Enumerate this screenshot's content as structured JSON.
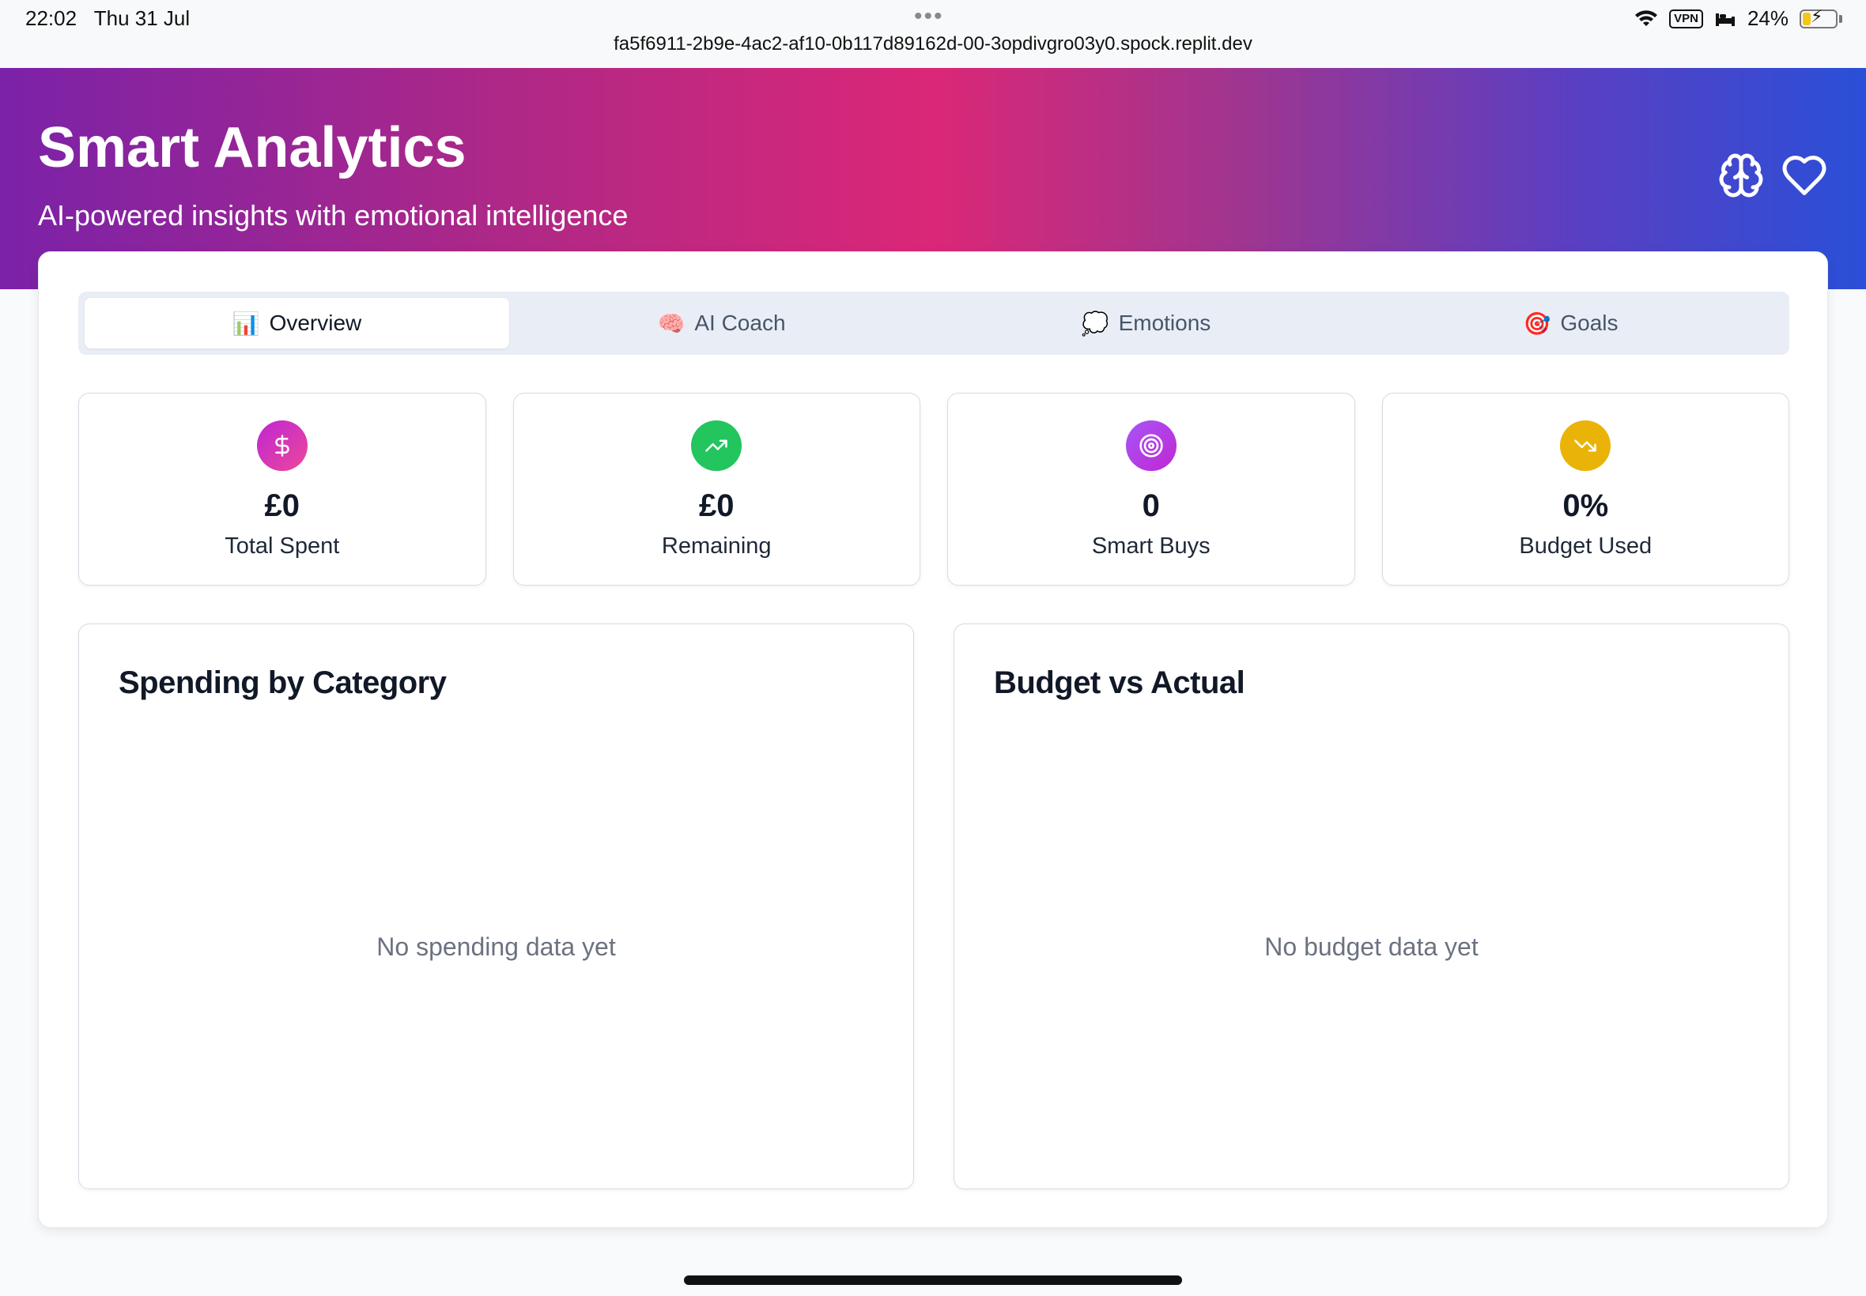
{
  "status_bar": {
    "time": "22:02",
    "date": "Thu 31 Jul",
    "url": "fa5f6911-2b9e-4ac2-af10-0b117d89162d-00-3opdivgro03y0.spock.replit.dev",
    "vpn": "VPN",
    "battery_percent": "24%",
    "battery_level": 0.24
  },
  "header": {
    "title": "Smart Analytics",
    "subtitle": "AI-powered insights with emotional intelligence",
    "icons": [
      "brain-icon",
      "heart-icon"
    ]
  },
  "tabs": [
    {
      "emoji": "📊",
      "label": "Overview",
      "active": true
    },
    {
      "emoji": "🧠",
      "label": "AI Coach",
      "active": false
    },
    {
      "emoji": "💭",
      "label": "Emotions",
      "active": false
    },
    {
      "emoji": "🎯",
      "label": "Goals",
      "active": false
    }
  ],
  "stats": [
    {
      "value": "£0",
      "label": "Total Spent",
      "icon": "dollar-icon",
      "color": "#d946ef"
    },
    {
      "value": "£0",
      "label": "Remaining",
      "icon": "trending-up-icon",
      "color": "#22c55e"
    },
    {
      "value": "0",
      "label": "Smart Buys",
      "icon": "target-icon",
      "color": "#a855f7"
    },
    {
      "value": "0%",
      "label": "Budget Used",
      "icon": "trending-down-icon",
      "color": "#eab308"
    }
  ],
  "panels": {
    "spending": {
      "title": "Spending by Category",
      "empty": "No spending data yet"
    },
    "budget": {
      "title": "Budget vs Actual",
      "empty": "No budget data yet"
    }
  }
}
